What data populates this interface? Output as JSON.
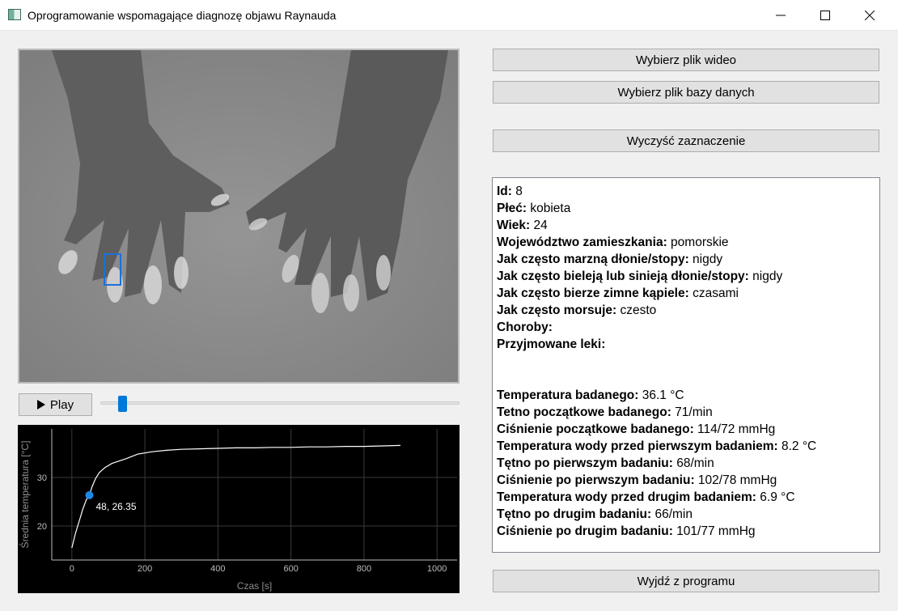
{
  "window": {
    "title": "Oprogramowanie wspomagające diagnozę objawu Raynauda"
  },
  "player": {
    "play_label": "Play",
    "play_icon": "play-icon",
    "slider_value_fraction": 0.05
  },
  "chart_data": {
    "type": "line",
    "xlabel": "Czas [s]",
    "ylabel": "Średnia temperatura [°C]",
    "x_ticks": [
      "0",
      "200",
      "400",
      "600",
      "800",
      "1000"
    ],
    "y_ticks": [
      "20",
      "30"
    ],
    "xlim": [
      -55,
      1055
    ],
    "ylim": [
      13,
      40
    ],
    "grid": true,
    "series": [
      {
        "x": [
          0,
          10,
          20,
          30,
          40,
          48,
          55,
          65,
          75,
          90,
          110,
          130,
          150,
          180,
          220,
          260,
          300,
          350,
          400,
          450,
          500,
          550,
          600,
          650,
          700,
          750,
          800,
          850,
          900
        ],
        "y": [
          15.5,
          18.5,
          21,
          23.5,
          25.5,
          26.35,
          28,
          29.8,
          31,
          32,
          32.9,
          33.4,
          33.9,
          34.8,
          35.3,
          35.6,
          35.8,
          35.9,
          36.0,
          36.1,
          36.1,
          36.2,
          36.2,
          36.3,
          36.3,
          36.4,
          36.4,
          36.5,
          36.6
        ]
      }
    ],
    "marker": {
      "x": 48,
      "y": 26.35,
      "label": "48, 26.35"
    },
    "colors": {
      "line": "#ffffff",
      "marker": "#1e88e5",
      "background": "#000000",
      "grid": "#3a3a3a"
    }
  },
  "buttons": {
    "choose_video": "Wybierz plik wideo",
    "choose_db": "Wybierz plik bazy danych",
    "clear_selection": "Wyczyść zaznaczenie",
    "exit": "Wyjdź z programu"
  },
  "patient_info": {
    "block1": [
      {
        "label": "Id:",
        "value": " 8"
      },
      {
        "label": "Płeć:",
        "value": " kobieta"
      },
      {
        "label": "Wiek:",
        "value": " 24"
      },
      {
        "label": "Województwo zamieszkania:",
        "value": " pomorskie"
      },
      {
        "label": "Jak często marzną dłonie/stopy:",
        "value": " nigdy"
      },
      {
        "label": "Jak często bieleją lub sinieją dłonie/stopy:",
        "value": " nigdy"
      },
      {
        "label": "Jak często bierze zimne kąpiele:",
        "value": " czasami"
      },
      {
        "label": "Jak często morsuje:",
        "value": " czesto"
      },
      {
        "label": "Choroby:",
        "value": ""
      },
      {
        "label": "Przyjmowane leki:",
        "value": ""
      }
    ],
    "block2": [
      {
        "label": "Temperatura badanego:",
        "value": " 36.1 °C"
      },
      {
        "label": "Tetno początkowe badanego:",
        "value": " 71/min"
      },
      {
        "label": "Ciśnienie początkowe badanego:",
        "value": " 114/72 mmHg"
      },
      {
        "label": "Temperatura wody przed pierwszym badaniem:",
        "value": " 8.2 °C"
      },
      {
        "label": "Tętno po pierwszym badaniu:",
        "value": " 68/min"
      },
      {
        "label": "Ciśnienie po pierwszym badaniu:",
        "value": " 102/78 mmHg"
      },
      {
        "label": "Temperatura wody przed drugim badaniem:",
        "value": " 6.9 °C"
      },
      {
        "label": "Tętno po drugim badaniu:",
        "value": " 66/min"
      },
      {
        "label": "Ciśnienie po drugim badaniu:",
        "value": " 101/77 mmHg"
      }
    ]
  }
}
